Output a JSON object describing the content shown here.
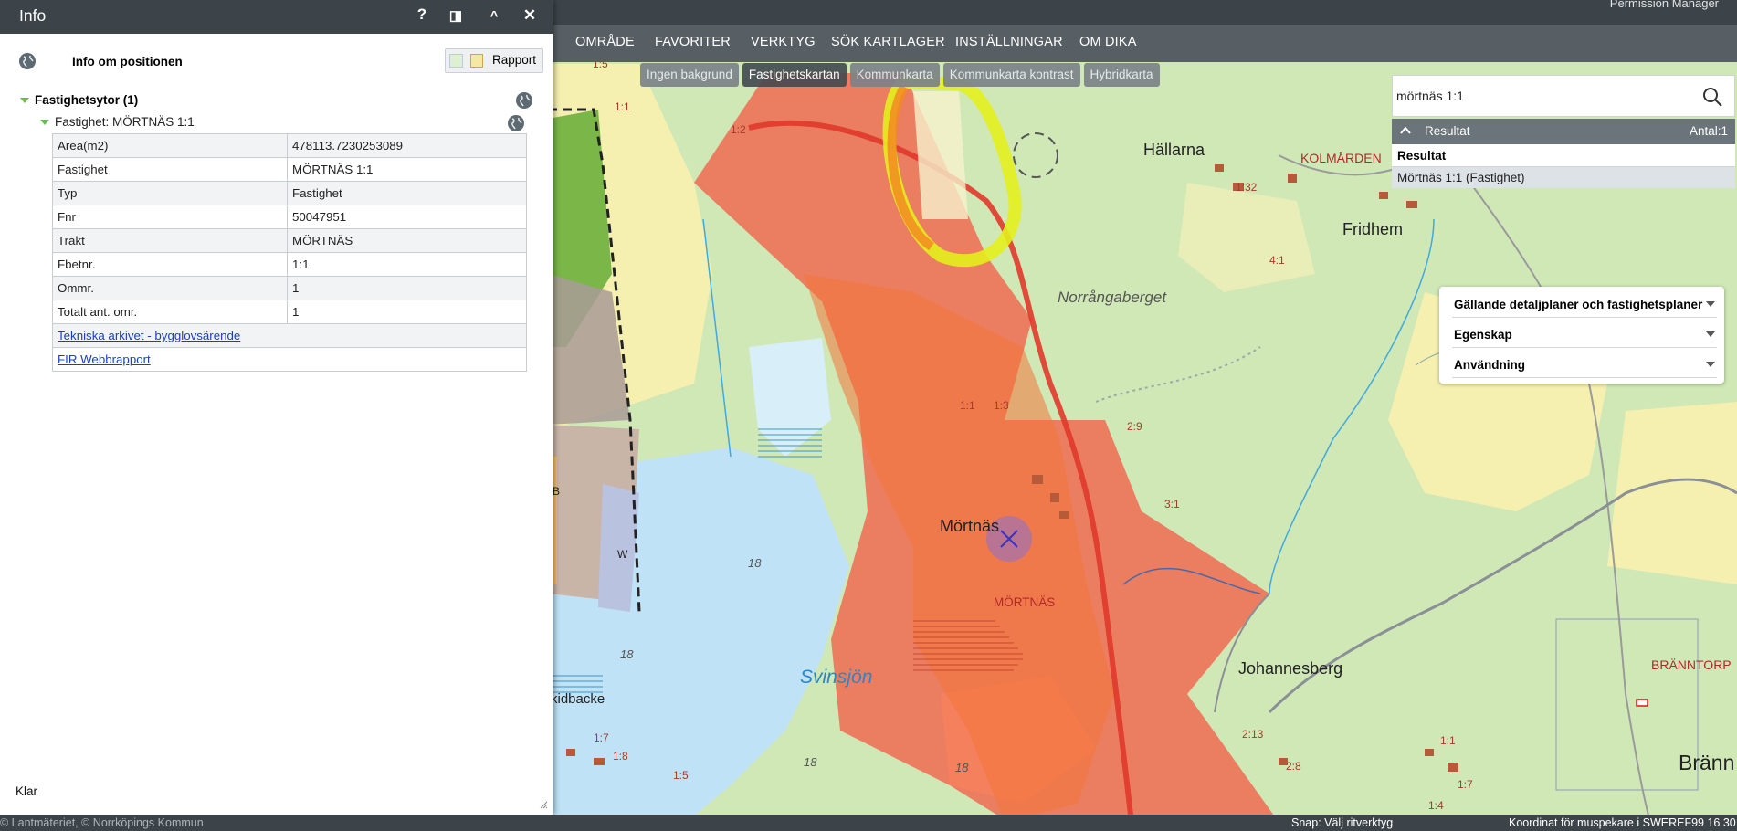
{
  "top": {
    "permission": "Permission Manager"
  },
  "nav": [
    "OMRÅDE",
    "FAVORITER",
    "VERKTYG",
    "SÖK KARTLAGER",
    "INSTÄLLNINGAR",
    "OM DIKA"
  ],
  "tabs": [
    "Ingen bakgrund",
    "Fastighetskartan",
    "Kommunkarta",
    "Kommunkarta kontrast",
    "Hybridkarta"
  ],
  "search": {
    "value": "mörtnäs 1:1",
    "icon": "search-icon"
  },
  "results": {
    "header": "Resultat",
    "count": "Antal:1",
    "subheader": "Resultat",
    "items": [
      "Mörtnäs 1:1 (Fastighet)"
    ]
  },
  "layers": [
    "Gällande detaljplaner och fastighetsplaner",
    "Egenskap",
    "Användning"
  ],
  "panel": {
    "title": "Info",
    "buttons": {
      "help": "?",
      "dock": "◨",
      "collapse": "^",
      "close": "✕"
    },
    "subtitle": "Info om positionen",
    "rapport": "Rapport",
    "tree": {
      "group": "Fastighetsytor (1)",
      "item": "Fastighet: MÖRTNÄS 1:1"
    },
    "rows": [
      {
        "k": "Area(m2)",
        "v": "478113.7230253089"
      },
      {
        "k": "Fastighet",
        "v": "MÖRTNÄS 1:1"
      },
      {
        "k": "Typ",
        "v": "Fastighet"
      },
      {
        "k": "Fnr",
        "v": "50047951"
      },
      {
        "k": "Trakt",
        "v": "MÖRTNÄS"
      },
      {
        "k": "Fbetnr.",
        "v": "1:1"
      },
      {
        "k": "Ommr.",
        "v": "1"
      },
      {
        "k": "Totalt ant. omr.",
        "v": "1"
      }
    ],
    "links": [
      "Tekniska arkivet - bygglovsärende",
      "FIR Webbrapport"
    ],
    "status": "Klar"
  },
  "map_labels": {
    "hallarna": "Hällarna",
    "kolmarden": "KOLMÅRDEN",
    "fridhem": "Fridhem",
    "norrangaberget": "Norrångaberget",
    "mortnas": "Mörtnäs",
    "mortnas_caps": "MÖRTNÄS",
    "svinsjon": "Svinsjön",
    "johannesberg": "Johannesberg",
    "branntorp": "BRÄNNTORP",
    "brann": "Bränn",
    "kidbacke": "kidbacke",
    "depths": [
      "18",
      "18",
      "18",
      "18"
    ],
    "parcels": [
      "1:5",
      "1:1",
      "1:2",
      "1:32",
      "4:1",
      "1:1",
      "1:3",
      "2:9",
      "3:1",
      "1:7",
      "1:8",
      "1:5",
      "2:13",
      "2:8",
      "1:1",
      "1:7",
      "1:4",
      "W",
      "B"
    ]
  },
  "status": {
    "copyright": "© Lantmäteriet, © Norrköpings Kommun",
    "snap": "Snap: Välj ritverktyg",
    "coord": "Koordinat för muspekare i SWEREF99 16 30"
  }
}
